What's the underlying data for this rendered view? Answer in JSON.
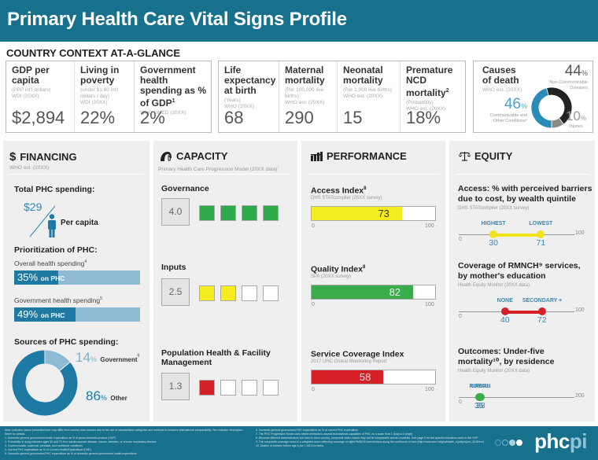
{
  "header": {
    "title": "Primary Health Care Vital Signs Profile"
  },
  "context": {
    "title": "COUNTRY CONTEXT AT-A-GLANCE",
    "group1": [
      {
        "label": "GDP per capita",
        "sup": "",
        "source_line1": "(PPP int'l dollars)",
        "source_line2": "WDI (20XX)",
        "value": "$2,894"
      },
      {
        "label": "Living in poverty",
        "sup": "",
        "source_line1": "(under $1.90 int'l dollars / day)",
        "source_line2": "WDI (20XX)",
        "value": "22%"
      },
      {
        "label": "Government health spending as % of GDP",
        "sup": "1",
        "source_line1": "WHO GHED (20XX)",
        "source_line2": "",
        "value": "2%"
      }
    ],
    "group2": [
      {
        "label": "Life expectancy at birth",
        "sup": "",
        "source_line1": "(Years)",
        "source_line2": "WHO (20XX)",
        "value": "68"
      },
      {
        "label": "Maternal mortality",
        "sup": "",
        "source_line1": "(Per 100,000 live births)",
        "source_line2": "WHO est. (20XX)",
        "value": "290"
      },
      {
        "label": "Neonatal mortality",
        "sup": "",
        "source_line1": "(Per 1,000 live births)",
        "source_line2": "WHO est. (20XX)",
        "value": "15"
      },
      {
        "label": "Premature NCD mortality",
        "sup": "2",
        "source_line1": "(Probability)",
        "source_line2": "WHO est. (20XX)",
        "value": "18%"
      }
    ],
    "causes": {
      "label_line1": "Causes",
      "label_line2": "of death",
      "source": "WHO est. (20XX)",
      "ncd_pct": "44",
      "ncd_label_line1": "Non-Communicable",
      "ncd_label_line2": "Diseases",
      "comm_pct": "46",
      "comm_label_line1": "Communicable and",
      "comm_label_line2": "Other Conditions³",
      "inj_pct": "10",
      "inj_label": "Injuries",
      "pct_sign": "%",
      "colors": {
        "ncd": "#222222",
        "comm": "#2a8bb8",
        "inj": "#8c8c84"
      }
    }
  },
  "financing": {
    "title": "FINANCING",
    "icon": "$",
    "source": "WHO est. (20XX)",
    "total_title": "Total PHC spending:",
    "per_capita_value": "$29",
    "per_capita_label": "Per capita",
    "prioritization_title": "Prioritization of PHC:",
    "overall_label": "Overall health spending",
    "overall_sup": "4",
    "overall_pct": 35,
    "overall_text": "35%",
    "gov_label": "Government health spending",
    "gov_sup": "5",
    "gov_pct": 49,
    "gov_text": "49%",
    "on_phc": "on PHC",
    "sources_title": "Sources of PHC spending:",
    "gov_share": "14",
    "gov_share_label": "Government",
    "gov_share_sup": "6",
    "other_share": "86",
    "other_share_label": "Other",
    "pct_sign": "%"
  },
  "capacity": {
    "title": "CAPACITY",
    "source": "Primary Health Care Progression Model (20XX data)",
    "source_sup": "7",
    "items": [
      {
        "label": "Governance",
        "score": "4.0",
        "filled": 4,
        "color": "#2eaa4a"
      },
      {
        "label": "Inputs",
        "score": "2.5",
        "filled": 2,
        "color": "#f5ec1f"
      },
      {
        "label": "Population Health & Facility Management",
        "score": "1.3",
        "filled": 1,
        "color": "#d62027"
      }
    ]
  },
  "performance": {
    "title": "PERFORMANCE",
    "axis_min": "0",
    "axis_max": "100",
    "items": [
      {
        "label": "Access Index",
        "sup": "8",
        "source": "DHS STATcompiler (20XX survey)",
        "value": 73,
        "value_text": "73",
        "color": "#f5ec1f",
        "text_color": "#333333"
      },
      {
        "label": "Quality Index",
        "sup": "8",
        "source": "SPA (20XX survey)",
        "value": 82,
        "value_text": "82",
        "color": "#3aac4c",
        "text_color": "#e8f5e8"
      },
      {
        "label": "Service Coverage Index",
        "sup": "",
        "source": "2017 UHC Global Monitoring Report",
        "value": 58,
        "value_text": "58",
        "color": "#d42026",
        "text_color": "#ffe0e0"
      }
    ]
  },
  "equity": {
    "title": "EQUITY",
    "items": [
      {
        "title_line1": "Access: % with perceived barriers",
        "title_line2": "due to cost, by wealth quintile",
        "sup": "",
        "source": "DHS STATcompiler (20XX survey)",
        "low_label": "HIGHEST",
        "high_label": "LOWEST",
        "low": 30,
        "high": 71,
        "low_text": "30",
        "high_text": "71",
        "max": 100,
        "axis_min": "0",
        "axis_max": "100",
        "color": "#f0e31c"
      },
      {
        "title_line1": "Coverage of RMNCH⁹ services,",
        "title_line2": "by mother's education",
        "sup": "",
        "source": "Health Equity Monitor (20XX data)",
        "low_label": "NONE",
        "high_label": "SECONDARY +",
        "low": 40,
        "high": 72,
        "low_text": "40",
        "high_text": "72",
        "max": 100,
        "axis_min": "0",
        "axis_max": "100",
        "color": "#d42026"
      },
      {
        "title_line1": "Outcomes: Under-five",
        "title_line2": "mortality¹⁰, by residence",
        "sup": "",
        "source": "Health Equity Monitor (20XX data)",
        "low_label": "RURAL",
        "high_label": "URBAN",
        "low": 35,
        "high": 38,
        "low_text": "35",
        "high_text": "38",
        "max": 200,
        "axis_min": "0",
        "axis_max": "200",
        "color": "#3aac4c"
      }
    ]
  },
  "footer": {
    "note": "Note: Indicator values presented here may differ from country data sources due to the use of standardized categories and methods to enhance international comparability. See indicator description Sheet for details.",
    "notes_left": [
      "1.  Domestic general government health expenditure as % of gross domestic product (GDP)",
      "2.  Probability of dying between ages 30 and 70 from cardiovascular disease, cancer, diabetes, or chronic respiratory disease",
      "3.  Communicable, maternal, perinatal, and nutritional conditions",
      "4.  Current PHC expenditure as % of Current Health Expenditure (CHE)",
      "5.  Domestic general government PHC expenditure as % of domestic general government health expenditure"
    ],
    "notes_right": [
      "6.  Domestic general government PHC expenditure as % of current PHC expenditure",
      "7.  The PHC Progression Model uses mixed methods to assess foundational capacities of PHC on a scale from 1 (low) to 4 (high)",
      "8.  Because different data/indicators are used in each country, composite index values may not be comparable across countries. See page 2 for the specific indicators used in this VSP.",
      "9.  The composite coverage index is a weighted score reflecting coverage of eight RMNCH interventions along the continuum of care (http://www.who.int/gho/health_equity/report_2015/en/)",
      "10. Deaths of children before age 5 per 1,000 live births"
    ],
    "logo_main": "phc",
    "logo_accent": "pi"
  }
}
